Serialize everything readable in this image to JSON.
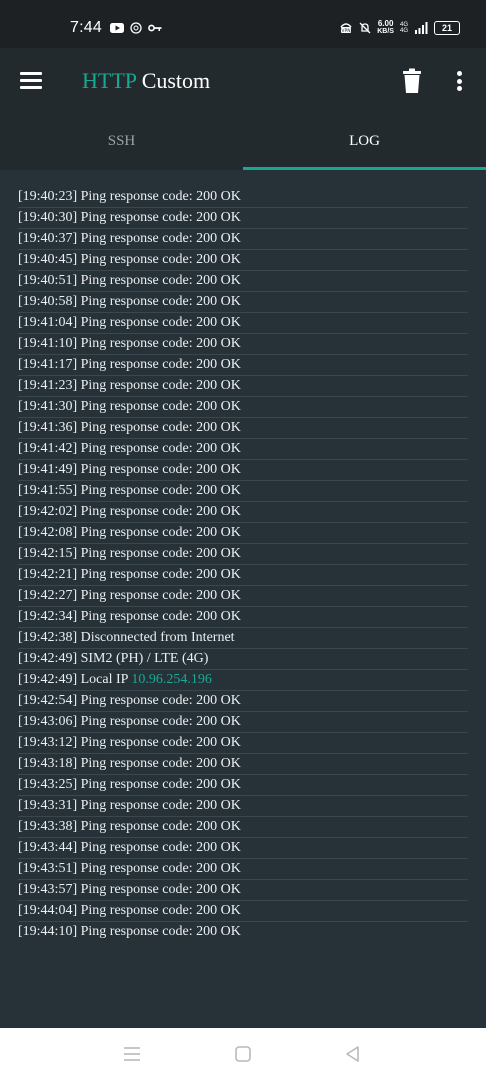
{
  "status_bar": {
    "time": "7:44",
    "net_speed_value": "6.00",
    "net_speed_unit": "KB/S",
    "net_type_top": "4G",
    "net_type_bottom": "4G",
    "battery": "21",
    "icons_left": [
      "youtube-icon",
      "whatsapp-icon",
      "key-icon"
    ],
    "icons_right": [
      "vpn-icon",
      "mute-icon",
      "signal-icon",
      "battery-icon"
    ]
  },
  "app_bar": {
    "title_part1": "HTTP",
    "title_part2": "Custom",
    "accent_color": "#1aa896"
  },
  "tabs": [
    {
      "label": "SSH",
      "selected": false
    },
    {
      "label": "LOG",
      "selected": true
    }
  ],
  "log": {
    "lines": [
      {
        "time": "[19:40:23]",
        "message": "Ping response code: 200 OK"
      },
      {
        "time": "[19:40:30]",
        "message": "Ping response code: 200 OK"
      },
      {
        "time": "[19:40:37]",
        "message": "Ping response code: 200 OK"
      },
      {
        "time": "[19:40:45]",
        "message": "Ping response code: 200 OK"
      },
      {
        "time": "[19:40:51]",
        "message": "Ping response code: 200 OK"
      },
      {
        "time": "[19:40:58]",
        "message": "Ping response code: 200 OK"
      },
      {
        "time": "[19:41:04]",
        "message": "Ping response code: 200 OK"
      },
      {
        "time": "[19:41:10]",
        "message": "Ping response code: 200 OK"
      },
      {
        "time": "[19:41:17]",
        "message": "Ping response code: 200 OK"
      },
      {
        "time": "[19:41:23]",
        "message": "Ping response code: 200 OK"
      },
      {
        "time": "[19:41:30]",
        "message": "Ping response code: 200 OK"
      },
      {
        "time": "[19:41:36]",
        "message": "Ping response code: 200 OK"
      },
      {
        "time": "[19:41:42]",
        "message": "Ping response code: 200 OK"
      },
      {
        "time": "[19:41:49]",
        "message": "Ping response code: 200 OK"
      },
      {
        "time": "[19:41:55]",
        "message": "Ping response code: 200 OK"
      },
      {
        "time": "[19:42:02]",
        "message": "Ping response code: 200 OK"
      },
      {
        "time": "[19:42:08]",
        "message": "Ping response code: 200 OK"
      },
      {
        "time": "[19:42:15]",
        "message": "Ping response code: 200 OK"
      },
      {
        "time": "[19:42:21]",
        "message": "Ping response code: 200 OK"
      },
      {
        "time": "[19:42:27]",
        "message": "Ping response code: 200 OK"
      },
      {
        "time": "[19:42:34]",
        "message": "Ping response code: 200 OK"
      },
      {
        "time": "[19:42:38]",
        "message": "Disconnected from Internet"
      },
      {
        "time": "[19:42:49]",
        "message": "SIM2 (PH) / LTE (4G)"
      },
      {
        "time": "[19:42:49]",
        "message": "Local IP",
        "ip": "10.96.254.196"
      },
      {
        "time": "[19:42:54]",
        "message": "Ping response code: 200 OK"
      },
      {
        "time": "[19:43:06]",
        "message": "Ping response code: 200 OK"
      },
      {
        "time": "[19:43:12]",
        "message": "Ping response code: 200 OK"
      },
      {
        "time": "[19:43:18]",
        "message": "Ping response code: 200 OK"
      },
      {
        "time": "[19:43:25]",
        "message": "Ping response code: 200 OK"
      },
      {
        "time": "[19:43:31]",
        "message": "Ping response code: 200 OK"
      },
      {
        "time": "[19:43:38]",
        "message": "Ping response code: 200 OK"
      },
      {
        "time": "[19:43:44]",
        "message": "Ping response code: 200 OK"
      },
      {
        "time": "[19:43:51]",
        "message": "Ping response code: 200 OK"
      },
      {
        "time": "[19:43:57]",
        "message": "Ping response code: 200 OK"
      },
      {
        "time": "[19:44:04]",
        "message": "Ping response code: 200 OK"
      },
      {
        "time": "[19:44:10]",
        "message": "Ping response code: 200 OK"
      }
    ]
  },
  "nav_bar": {
    "buttons": [
      "recents-icon",
      "home-icon",
      "back-icon"
    ]
  }
}
